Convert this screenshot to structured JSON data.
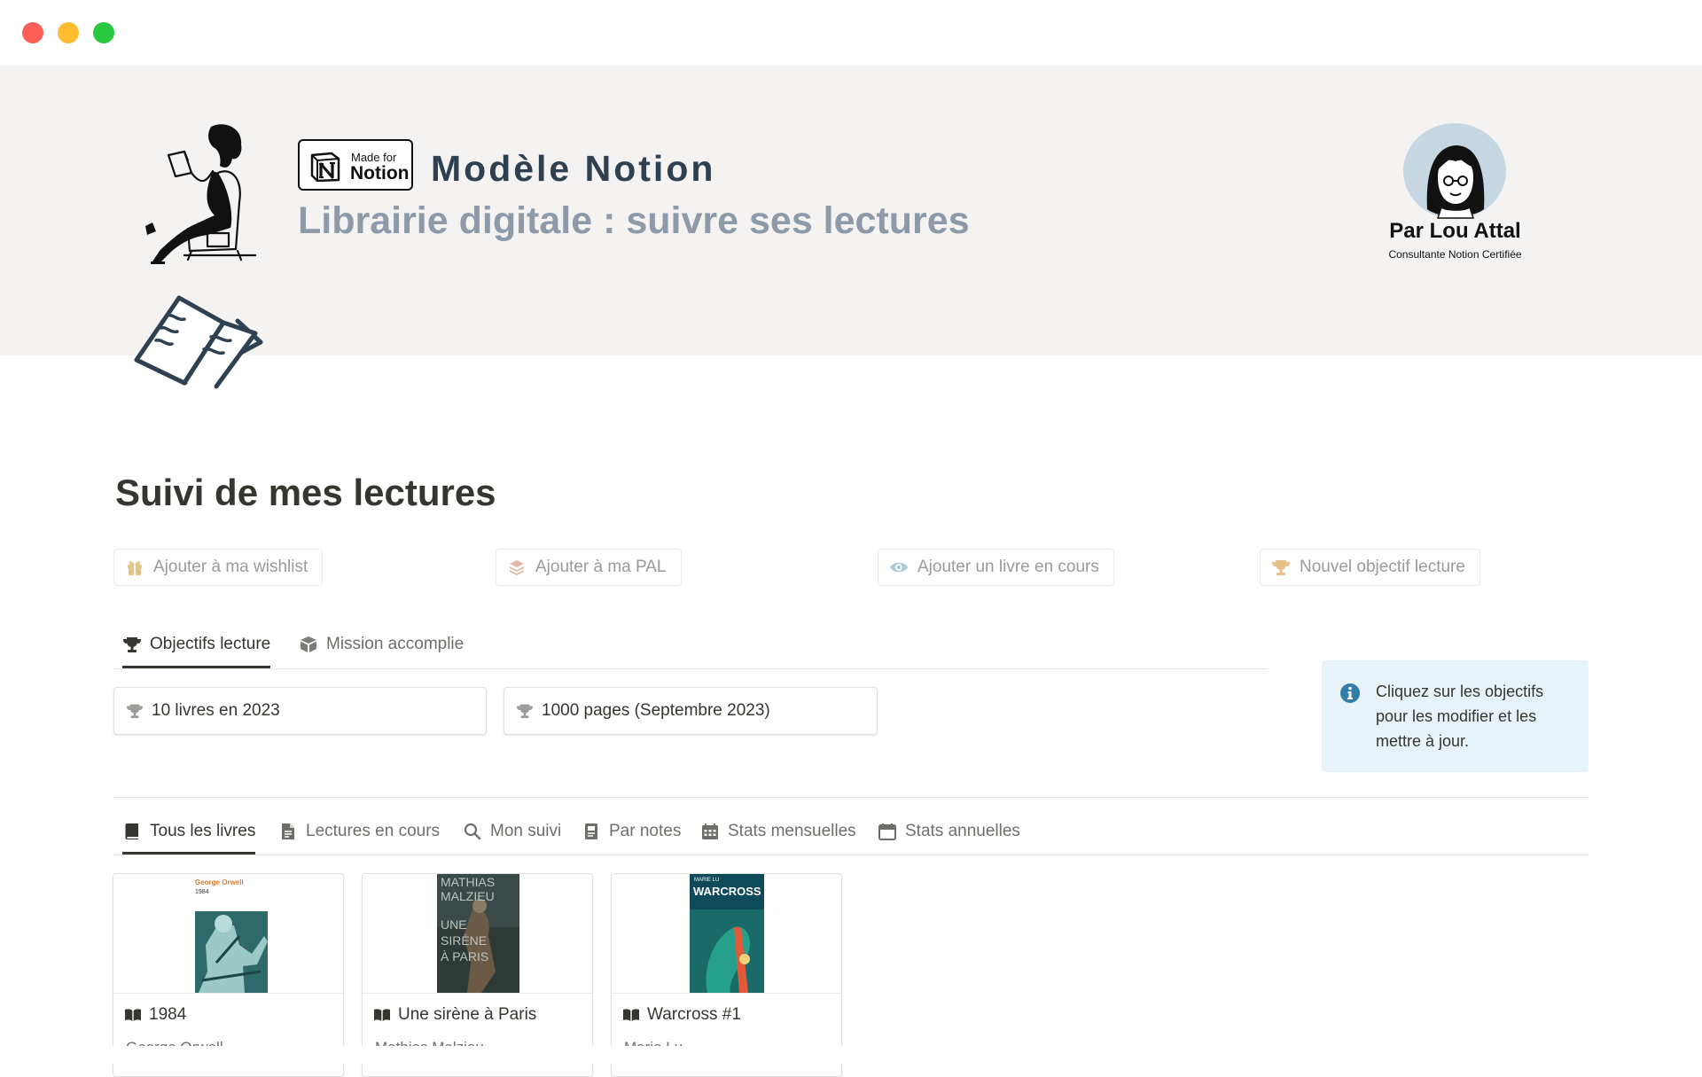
{
  "window": {
    "controls": [
      "close",
      "minimize",
      "maximize"
    ]
  },
  "banner": {
    "badge_small": "Made for",
    "badge_big": "Notion",
    "title": "Modèle Notion",
    "subtitle": "Librairie digitale : suivre ses lectures",
    "author_name": "Par Lou Attal",
    "author_role": "Consultante Notion Certifiée"
  },
  "page": {
    "title": "Suivi de mes lectures"
  },
  "template_buttons": [
    {
      "label": "Ajouter à ma wishlist",
      "icon": "gift-icon"
    },
    {
      "label": "Ajouter à ma PAL",
      "icon": "stack-icon"
    },
    {
      "label": "Ajouter un livre en cours",
      "icon": "eye-icon"
    },
    {
      "label": "Nouvel objectif lecture",
      "icon": "trophy-icon"
    }
  ],
  "goals_tabs": [
    {
      "label": "Objectifs lecture",
      "icon": "trophy-icon",
      "active": true
    },
    {
      "label": "Mission accomplie",
      "icon": "box-icon",
      "active": false
    }
  ],
  "goals": [
    {
      "label": "10 livres en 2023",
      "icon": "trophy-icon"
    },
    {
      "label": "1000 pages (Septembre 2023)",
      "icon": "trophy-icon"
    }
  ],
  "callout": {
    "text": "Cliquez sur les objectifs pour les modifier et les mettre à jour.",
    "icon": "info-icon"
  },
  "books_tabs": [
    {
      "label": "Tous les livres",
      "icon": "book-icon",
      "active": true
    },
    {
      "label": "Lectures en cours",
      "icon": "document-icon",
      "active": false
    },
    {
      "label": "Mon suivi",
      "icon": "search-icon",
      "active": false
    },
    {
      "label": "Par notes",
      "icon": "notebook-icon",
      "active": false
    },
    {
      "label": "Stats mensuelles",
      "icon": "calendar-grid-icon",
      "active": false
    },
    {
      "label": "Stats annuelles",
      "icon": "calendar-icon",
      "active": false
    }
  ],
  "books": [
    {
      "title": "1984",
      "author": "George Orwell",
      "cover_author": "George Orwell",
      "cover_title": "1984"
    },
    {
      "title": "Une sirène à Paris",
      "author": "Mathias Malzieu",
      "cover_lines": [
        "MATHIAS",
        "MALZIEU",
        "UNE",
        "SIRÈNE",
        "À PARIS"
      ]
    },
    {
      "title": "Warcross #1",
      "author": "Marie Lu",
      "cover_author": "MARIE LU",
      "cover_title": "WARCROSS"
    }
  ],
  "colors": {
    "banner_bg": "#f4f3f2",
    "banner_title": "#2f4050",
    "banner_subtitle": "#8e9aa8",
    "callout_bg": "#e7f3f8",
    "info_blue": "#337ea9",
    "text": "#37352f",
    "muted": "#9b9a97"
  }
}
